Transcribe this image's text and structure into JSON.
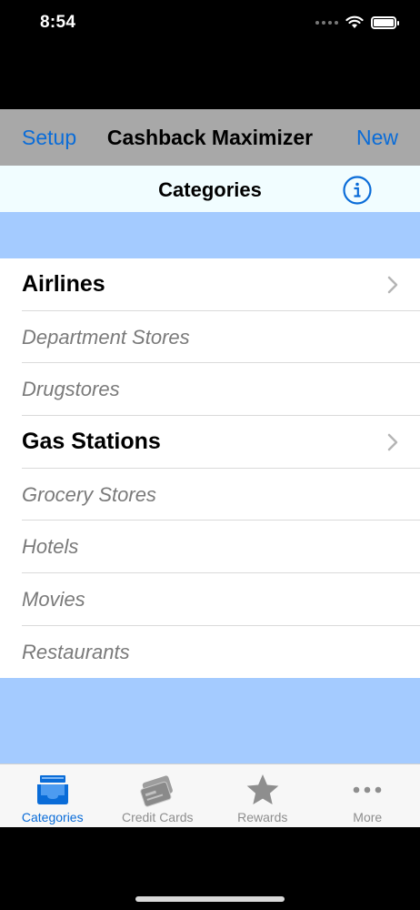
{
  "status": {
    "time": "8:54"
  },
  "navbar": {
    "left_button": "Setup",
    "title": "Cashback Maximizer",
    "right_button": "New"
  },
  "subheader": {
    "title": "Categories",
    "info_icon": "info-icon"
  },
  "categories": [
    {
      "label": "Airlines",
      "active": true
    },
    {
      "label": "Department Stores",
      "active": false
    },
    {
      "label": "Drugstores",
      "active": false
    },
    {
      "label": "Gas Stations",
      "active": true
    },
    {
      "label": "Grocery Stores",
      "active": false
    },
    {
      "label": "Hotels",
      "active": false
    },
    {
      "label": "Movies",
      "active": false
    },
    {
      "label": "Restaurants",
      "active": false
    }
  ],
  "tabs": [
    {
      "label": "Categories",
      "icon": "tray-icon",
      "selected": true
    },
    {
      "label": "Credit Cards",
      "icon": "credit-cards-icon",
      "selected": false
    },
    {
      "label": "Rewards",
      "icon": "star-icon",
      "selected": false
    },
    {
      "label": "More",
      "icon": "more-dots-icon",
      "selected": false
    }
  ],
  "colors": {
    "accent": "#0a6cd8",
    "navbar_bg": "#a8a8a8",
    "band_bg": "#a4cbff",
    "subheader_bg": "#f1fdff"
  }
}
